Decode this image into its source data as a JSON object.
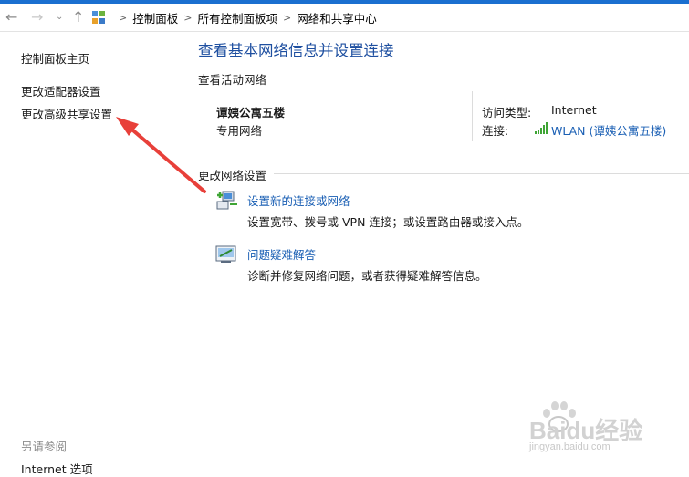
{
  "nav": {
    "back_icon": "back-arrow-icon",
    "forward_icon": "forward-arrow-icon",
    "dropdown_icon": "chevron-down-icon",
    "up_icon": "up-arrow-icon"
  },
  "breadcrumb": [
    "控制面板",
    "所有控制面板项",
    "网络和共享中心"
  ],
  "sidebar": {
    "home": "控制面板主页",
    "items": [
      "更改适配器设置",
      "更改高级共享设置"
    ],
    "see_also_label": "另请参阅",
    "see_also_items": [
      "Internet 选项"
    ]
  },
  "main": {
    "title": "查看基本网络信息并设置连接",
    "active_section": "查看活动网络",
    "network_name": "谭姨公寓五楼",
    "network_type": "专用网络",
    "access_type_label": "访问类型:",
    "access_type_value": "Internet",
    "connection_label": "连接:",
    "connection_value": "WLAN (谭姨公寓五楼)",
    "change_section": "更改网络设置",
    "tasks": [
      {
        "link": "设置新的连接或网络",
        "desc": "设置宽带、拨号或 VPN 连接；或设置路由器或接入点。"
      },
      {
        "link": "问题疑难解答",
        "desc": "诊断并修复网络问题，或者获得疑难解答信息。"
      }
    ]
  },
  "watermark": {
    "brand": "Baidu经验",
    "url": "jingyan.baidu.com"
  },
  "colors": {
    "accent": "#1a6fd0",
    "link": "#1a5fb4",
    "title": "#1e4fa0",
    "arrow": "#e8403a",
    "wifi": "#3fa535"
  }
}
